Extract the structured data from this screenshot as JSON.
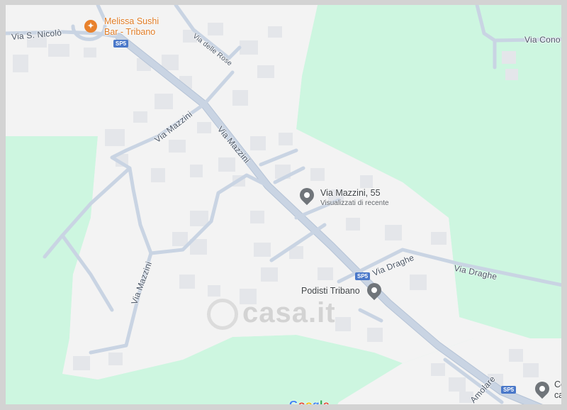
{
  "map": {
    "colors": {
      "green_area": "#cdf6e0",
      "urban_area": "#f3f3f3",
      "road": "#c9d4e3",
      "road_outline": "#b5c3d6",
      "building": "#e4e6ea",
      "pin": "#70757a",
      "food_pin": "#e8812c",
      "shield": "#4a78c9"
    },
    "streets": [
      {
        "id": "via-s-nicolo",
        "label": "Via S. Nicolò"
      },
      {
        "id": "via-delle-rose",
        "label": "Via delle Rose"
      },
      {
        "id": "via-mazzini-1",
        "label": "Via Mazzini"
      },
      {
        "id": "via-mazzini-2",
        "label": "Via Mazzini"
      },
      {
        "id": "via-mazzini-3",
        "label": "Via Mazzini"
      },
      {
        "id": "via-cono",
        "label": "Via Cono"
      },
      {
        "id": "via-draghe-1",
        "label": "Via Draghe"
      },
      {
        "id": "via-draghe-2",
        "label": "Via Draghe"
      },
      {
        "id": "via-amolare",
        "label": "Amolare"
      }
    ],
    "road_shields": [
      {
        "id": "sp5-top",
        "label": "SP5"
      },
      {
        "id": "sp5-mid",
        "label": "SP5"
      },
      {
        "id": "sp5-bottom",
        "label": "SP5"
      }
    ],
    "places": {
      "restaurant": {
        "name_line1": "Melissa Sushi",
        "name_line2": "Bar - Tribano",
        "icon": "fork-knife-icon"
      },
      "selected": {
        "name": "Via Mazzini, 55",
        "subtitle": "Visualizzati di recente",
        "icon": "place-pin-icon"
      },
      "podisti": {
        "name": "Podisti Tribano",
        "icon": "place-pin-icon"
      },
      "corner": {
        "name_line1": "Cer",
        "name_line2": "car",
        "icon": "place-pin-icon"
      }
    },
    "watermark": "casa.it",
    "google_logo": [
      "G",
      "o",
      "o",
      "g",
      "l",
      "e"
    ],
    "google_colors": [
      "#4285f4",
      "#ea4335",
      "#fbbc05",
      "#4285f4",
      "#34a853",
      "#ea4335"
    ]
  }
}
